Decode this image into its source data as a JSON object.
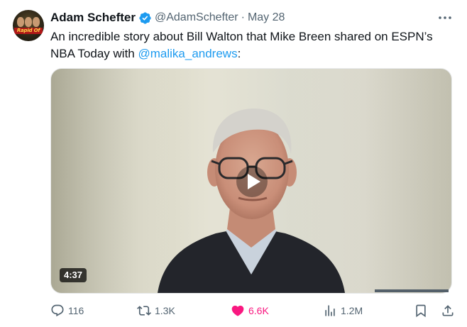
{
  "author": {
    "name": "Adam Schefter",
    "handle": "@AdamSchefter",
    "separator": "·",
    "date": "May 28",
    "avatar_text": "Rapid Of",
    "verified": true
  },
  "tweet": {
    "text_part1": "An incredible story about Bill Walton that Mike Breen shared on ESPN’s NBA Today with ",
    "mention": "@malika_andrews",
    "text_part2": ":"
  },
  "media": {
    "type": "video",
    "duration": "4:37",
    "play_icon": "play-icon"
  },
  "actions": {
    "replies": "116",
    "retweets": "1.3K",
    "likes": "6.6K",
    "views": "1.2M",
    "liked": true
  },
  "colors": {
    "link": "#1d9bf0",
    "like": "#f91880",
    "muted": "#536471",
    "verified": "#1d9bf0"
  }
}
